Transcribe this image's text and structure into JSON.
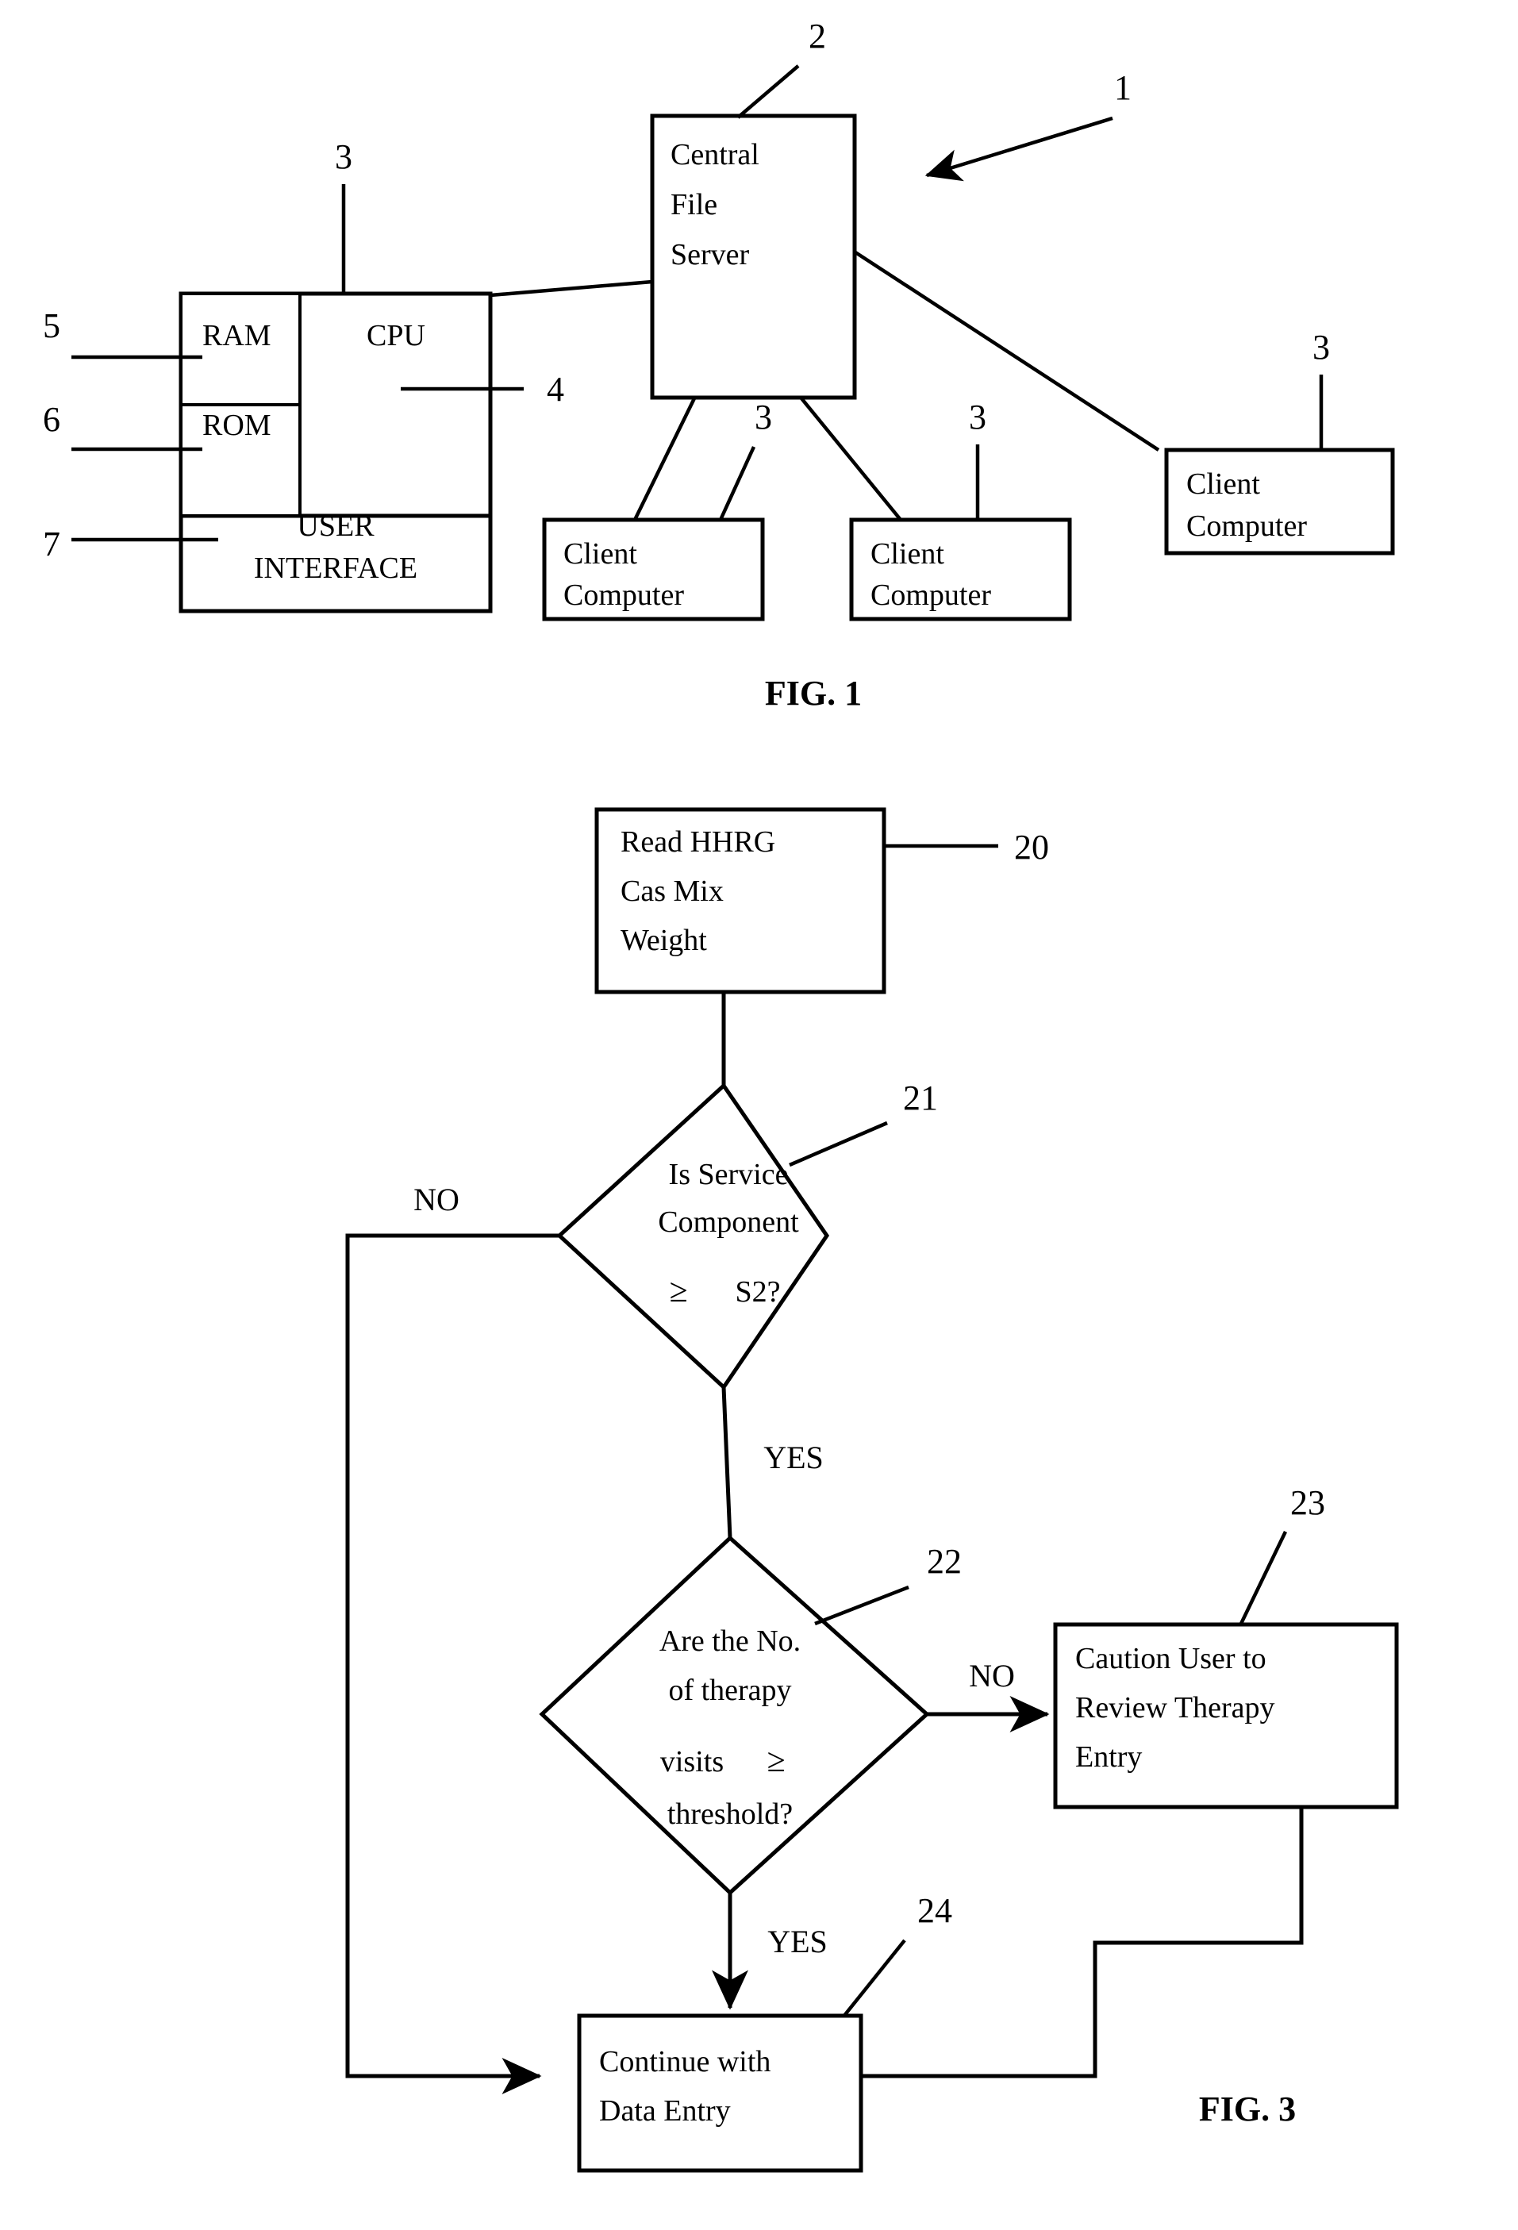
{
  "document": {
    "type": "patent-drawing-sheet",
    "figures": [
      {
        "caption": "FIG. 1",
        "title": "System architecture block diagram"
      },
      {
        "caption": "FIG. 3",
        "title": "Therapy visit validation flowchart"
      }
    ]
  },
  "fig1": {
    "caption": "FIG. 1",
    "system_ref": "1",
    "server": {
      "label_line1": "Central",
      "label_line2": "File",
      "label_line3": "Server",
      "ref": "2"
    },
    "workstation": {
      "ram_label": "RAM",
      "ram_ref": "5",
      "rom_label": "ROM",
      "rom_ref": "6",
      "cpu_label": "CPU",
      "cpu_ref": "4",
      "ui_line1": "USER",
      "ui_line2": "INTERFACE",
      "ui_ref": "7",
      "client_ref": "3"
    },
    "clients": [
      {
        "label_line1": "Client",
        "label_line2": "Computer",
        "ref": "3"
      },
      {
        "label_line1": "Client",
        "label_line2": "Computer",
        "ref": "3"
      },
      {
        "label_line1": "Client",
        "label_line2": "Computer",
        "ref": "3"
      }
    ]
  },
  "fig3": {
    "caption": "FIG. 3",
    "nodes": [
      {
        "id": "read-weight",
        "shape": "process",
        "ref": "20",
        "lines": [
          "Read HHRG",
          "Cas Mix",
          "Weight"
        ]
      },
      {
        "id": "service-component-decision",
        "shape": "decision",
        "ref": "21",
        "lines": [
          "Is Service",
          "Component"
        ],
        "compare_symbol": "≥",
        "compare_value": "S2?"
      },
      {
        "id": "therapy-visits-decision",
        "shape": "decision",
        "ref": "22",
        "lines": [
          "Are the No.",
          "of therapy"
        ],
        "compare_prefix": "visits",
        "compare_symbol": "≥",
        "compare_suffix": "threshold?"
      },
      {
        "id": "caution-user",
        "shape": "process",
        "ref": "23",
        "lines": [
          "Caution User to",
          "Review Therapy",
          "Entry"
        ]
      },
      {
        "id": "continue-data-entry",
        "shape": "process",
        "ref": "24",
        "lines": [
          "Continue with",
          "Data Entry"
        ]
      }
    ],
    "edge_labels": {
      "decision21_no": "NO",
      "decision21_yes": "YES",
      "decision22_no": "NO",
      "decision22_yes": "YES"
    }
  }
}
